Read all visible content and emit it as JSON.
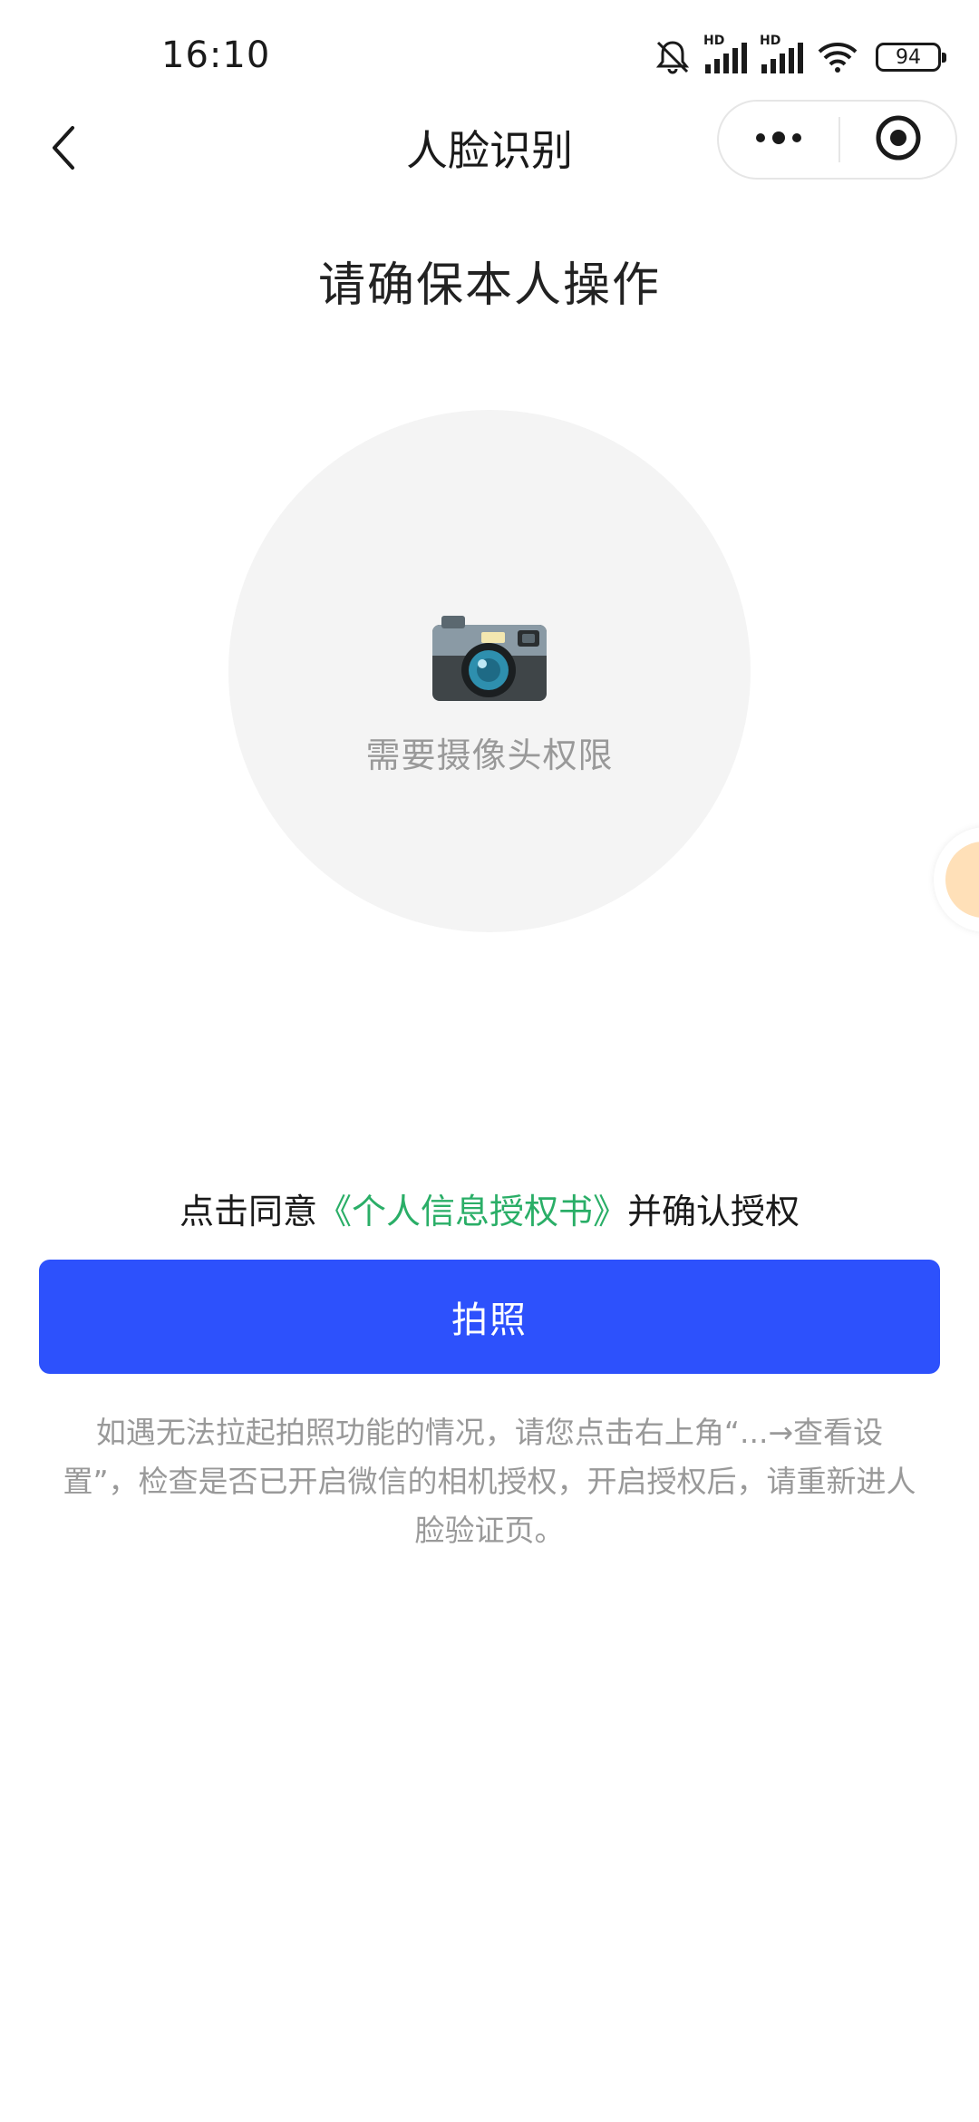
{
  "status_bar": {
    "time": "16:10",
    "battery": "94",
    "network_label_1": "HD",
    "network_label_2": "HD",
    "icons": [
      "mute-bell-icon",
      "signal-icon",
      "signal-icon",
      "wifi-icon",
      "battery-icon"
    ]
  },
  "nav": {
    "title": "人脸识别",
    "back_icon": "chevron-left-icon",
    "more_icon": "more-dots-icon",
    "close_icon": "target-close-icon"
  },
  "main": {
    "heading": "请确保本人操作",
    "camera_icon": "camera-icon",
    "camera_hint": "需要摄像头权限"
  },
  "consent": {
    "prefix": "点击同意",
    "link": "《个人信息授权书》",
    "suffix": "并确认授权"
  },
  "photo_button": {
    "label": "拍照"
  },
  "help": {
    "text": "如遇无法拉起拍照功能的情况，请您点击右上角“...→查看设置”，检查是否已开启微信的相机授权，开启授权后，请重新进人脸验证页。"
  },
  "colors": {
    "primary": "#2d51fc",
    "link": "#2aae67",
    "muted": "#999999",
    "circle_bg": "#f4f4f4"
  }
}
